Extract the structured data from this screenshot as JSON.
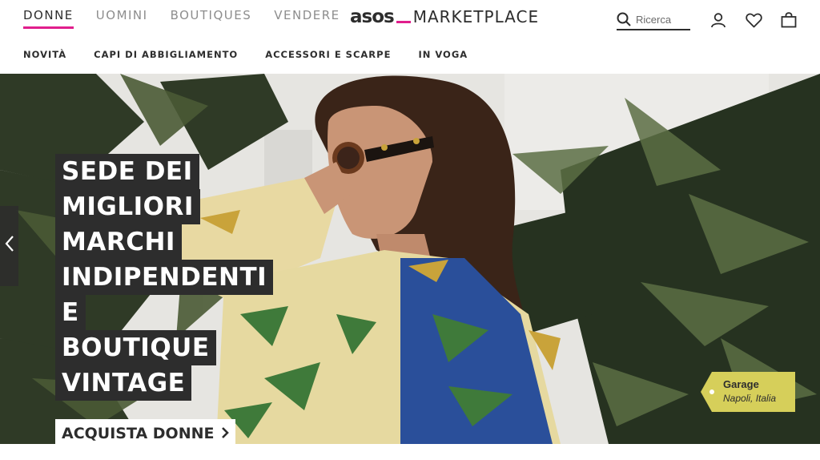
{
  "header": {
    "gender_tabs": [
      {
        "label": "DONNE",
        "active": true
      },
      {
        "label": "UOMINI",
        "active": false
      },
      {
        "label": "BOUTIQUES",
        "active": false
      },
      {
        "label": "VENDERE",
        "active": false
      }
    ],
    "logo": {
      "brand": "asos",
      "suffix": "MARKETPLACE"
    },
    "search": {
      "placeholder": "Ricerca",
      "value": ""
    },
    "icons": [
      "search-icon",
      "account-icon",
      "heart-icon",
      "bag-icon"
    ]
  },
  "sub_nav": {
    "items": [
      "NOVITÀ",
      "CAPI DI ABBIGLIAMENTO",
      "ACCESSORI E SCARPE",
      "IN VOGA"
    ]
  },
  "hero": {
    "headline_lines": [
      "SEDE DEI",
      "MIGLIORI",
      "MARCHI",
      "INDIPENDENTI",
      "E",
      "BOUTIQUE",
      "VINTAGE"
    ],
    "cta_label": "ACQUISTA DONNE",
    "prev_icon": "chevron-left-icon",
    "shop_tag": {
      "name": "Garage",
      "location": "Napoli, Italia"
    }
  },
  "colors": {
    "accent": "#e01e8c",
    "text": "#2d2d2d",
    "muted": "#8d8d8d",
    "tag_bg": "#d6cf5a"
  }
}
